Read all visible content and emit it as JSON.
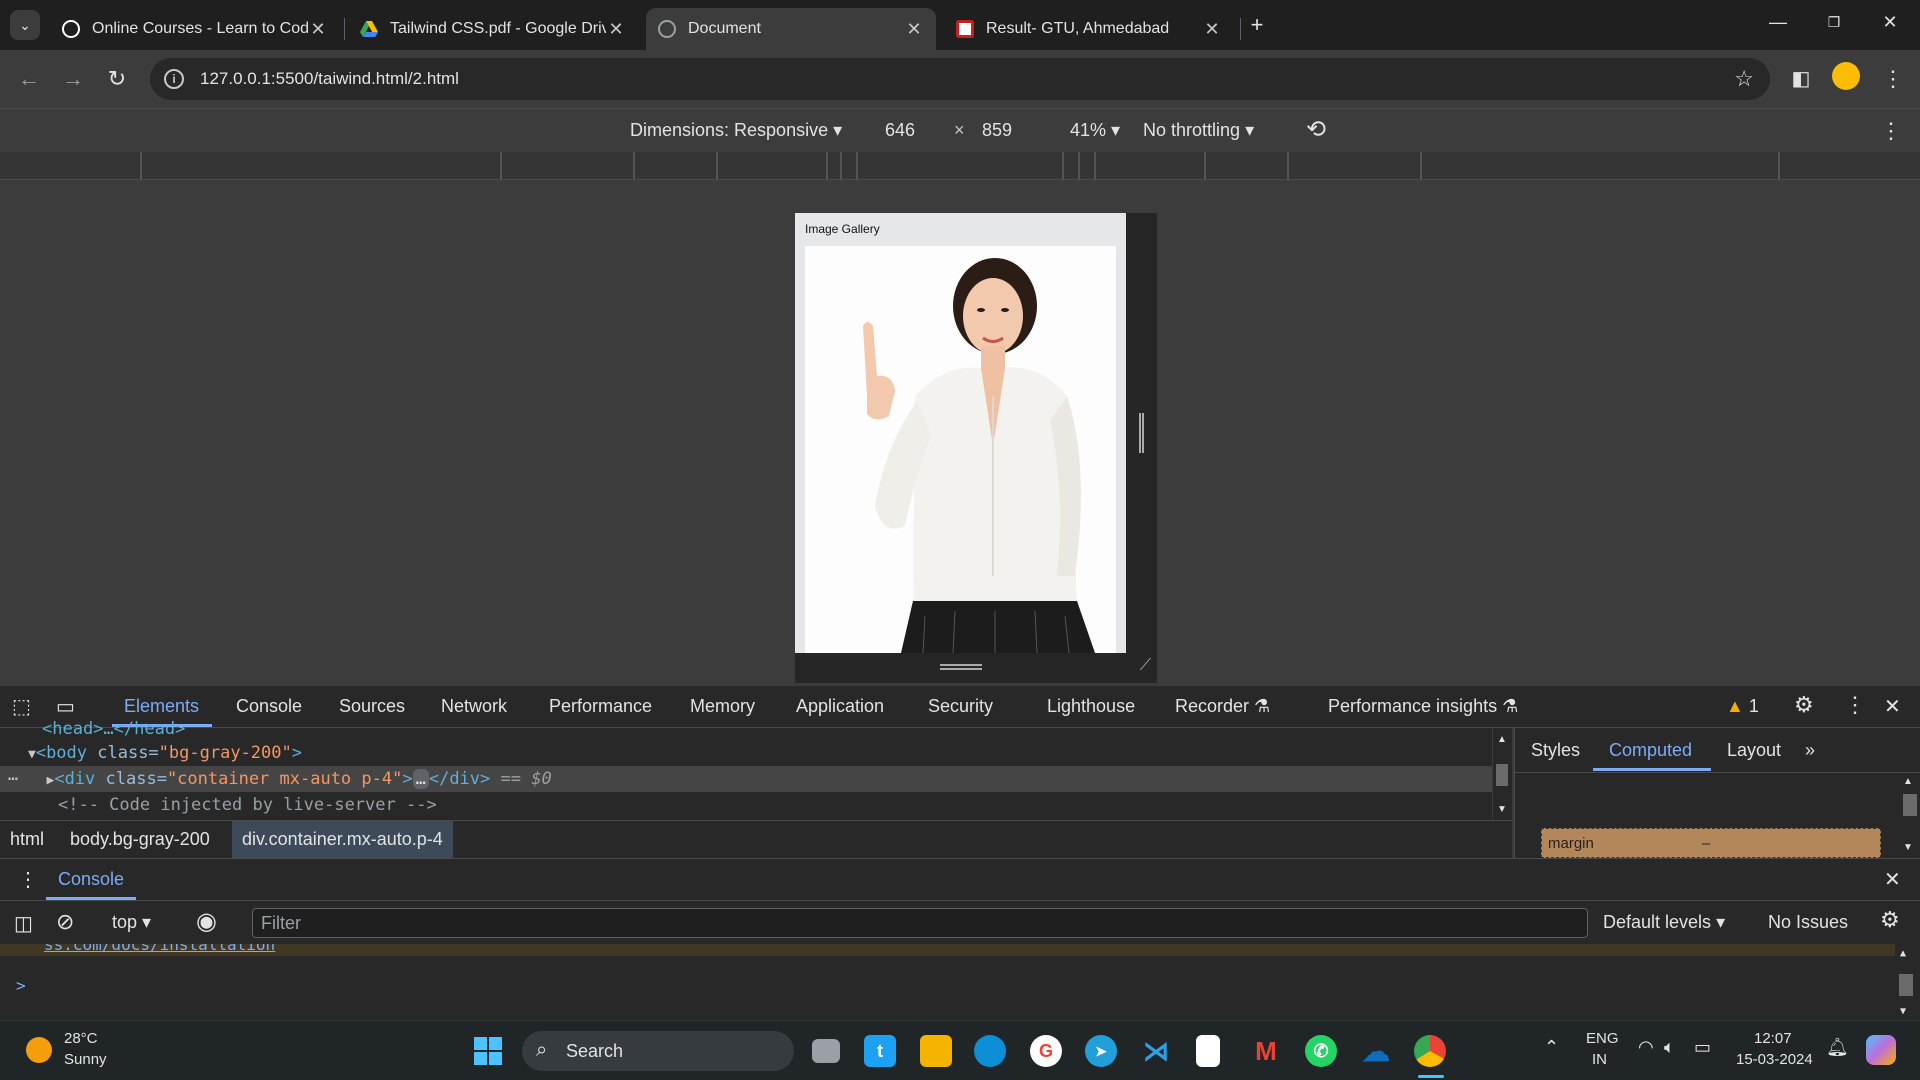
{
  "browser": {
    "tabs": [
      {
        "title": "Online Courses - Learn to Code",
        "favicon_color": "#ffffff"
      },
      {
        "title": "Tailwind CSS.pdf - Google Drive",
        "favicon_color": "#fbbc04"
      },
      {
        "title": "Document",
        "favicon_color": "#9aa0a6"
      },
      {
        "title": "Result- GTU, Ahmedabad",
        "favicon_color": "#c5221f"
      }
    ],
    "url": "127.0.0.1:5500/taiwind.html/2.html"
  },
  "device_toolbar": {
    "dimensions": "Dimensions: Responsive",
    "width": "646",
    "times": "×",
    "height": "859",
    "zoom": "41%",
    "throttling": "No throttling"
  },
  "page": {
    "title": "Image Gallery"
  },
  "devtools": {
    "tabs": [
      "Elements",
      "Console",
      "Sources",
      "Network",
      "Performance",
      "Memory",
      "Application",
      "Security",
      "Lighthouse",
      "Recorder",
      "Performance insights"
    ],
    "issues_count": "1",
    "elements": {
      "head_line": "<head>…</head>",
      "body_tag": "<body",
      "body_attr": " class=",
      "body_val": "\"bg-gray-200\"",
      "div_tag": "<div",
      "div_attr": " class=",
      "div_val": "\"container mx-auto p-4\"",
      "div_close": "</div>",
      "div_eq": " == $0",
      "comment": "<!-- Code injected by live-server -->"
    },
    "breadcrumbs": [
      "html",
      "body.bg-gray-200",
      "div.container.mx-auto.p-4"
    ],
    "side_tabs": [
      "Styles",
      "Computed",
      "Layout"
    ],
    "margin_label": "margin",
    "margin_value": "–",
    "console": {
      "title": "Console",
      "context": "top",
      "filter_placeholder": "Filter",
      "levels": "Default levels",
      "issues": "No Issues",
      "warn_link": "ss.com/docs/installation",
      "prompt": ">"
    }
  },
  "taskbar": {
    "weather_temp": "28°C",
    "weather_desc": "Sunny",
    "search_label": "Search",
    "lang_top": "ENG",
    "lang_bottom": "IN",
    "time": "12:07",
    "date": "15-03-2024"
  }
}
